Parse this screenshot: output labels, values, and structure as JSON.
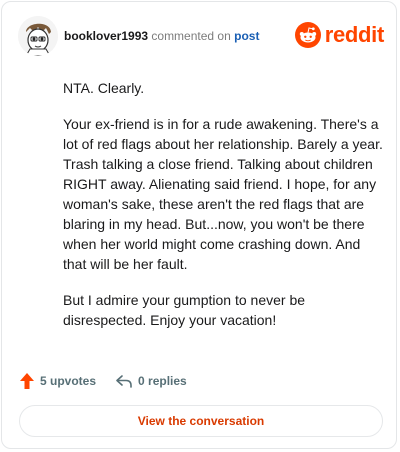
{
  "header": {
    "username": "booklover1993",
    "action_text": "commented on",
    "post_link": "post",
    "brand": "reddit"
  },
  "comment": {
    "paragraphs": [
      "NTA. Clearly.",
      "Your ex-friend is in for a rude awakening. There's a lot of red flags about her relationship. Barely a year. Trash talking a close friend. Talking about children RIGHT away. Alienating said friend. I hope, for any woman's sake, these aren't the red flags that are blaring in my head. But...now, you won't be there when her world might come crashing down. And that will be her fault.",
      "But I admire your gumption to never be disrespected. Enjoy your vacation!"
    ]
  },
  "actions": {
    "upvotes": "5 upvotes",
    "replies": "0 replies"
  },
  "cta": {
    "label": "View the conversation"
  },
  "colors": {
    "brand": "#ff4500",
    "link": "#1a5fb4",
    "cta_text": "#d93a00",
    "upvote_arrow": "#ff4500"
  }
}
